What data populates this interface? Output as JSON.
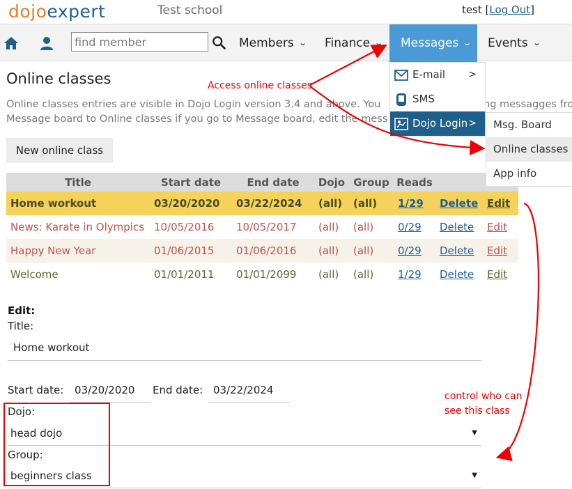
{
  "header": {
    "logo_part1": "dojo",
    "logo_part2": "expert",
    "school": "Test school",
    "user": "test",
    "logout": "Log Out"
  },
  "nav": {
    "search_placeholder": "find member",
    "members": "Members",
    "finance": "Finance",
    "messages": "Messages",
    "events": "Events"
  },
  "messages_menu": {
    "items": [
      {
        "label": "E-mail",
        "icon": "envelope-icon"
      },
      {
        "label": "SMS",
        "icon": "phone-icon"
      },
      {
        "label": "Dojo Login",
        "icon": "login-icon"
      }
    ],
    "submenu": [
      "Msg. Board",
      "Online classes",
      "App info"
    ]
  },
  "page": {
    "title": "Online classes",
    "desc_line1": "Online classes entries are visible in Dojo Login version 3.4 and above. You",
    "desc_line1_tail": "ng messagges fro",
    "desc_line2": "Message board to Online classes if you go to Message board, edit the mess",
    "new_button": "New online class"
  },
  "table": {
    "headers": [
      "Title",
      "Start date",
      "End date",
      "Dojo",
      "Group",
      "Reads",
      "",
      ""
    ],
    "rows": [
      {
        "title": "Home workout",
        "start": "03/20/2020",
        "end": "03/22/2024",
        "dojo": "(all)",
        "group": "(all)",
        "reads": "1/29",
        "delete": "Delete",
        "edit": "Edit"
      },
      {
        "title": "News: Karate in Olympics",
        "start": "10/05/2016",
        "end": "10/05/2017",
        "dojo": "(all)",
        "group": "(all)",
        "reads": "0/29",
        "delete": "Delete",
        "edit": "Edit"
      },
      {
        "title": "Happy New Year",
        "start": "01/06/2015",
        "end": "01/06/2016",
        "dojo": "(all)",
        "group": "(all)",
        "reads": "0/29",
        "delete": "Delete",
        "edit": "Edit"
      },
      {
        "title": "Welcome",
        "start": "01/01/2011",
        "end": "01/01/2099",
        "dojo": "(all)",
        "group": "(all)",
        "reads": "1/29",
        "delete": "Delete",
        "edit": "Edit"
      }
    ]
  },
  "edit": {
    "heading": "Edit:",
    "title_label": "Title:",
    "title_value": "Home workout",
    "start_label": "Start date:",
    "start_value": "03/20/2020",
    "end_label": "End date:",
    "end_value": "03/22/2024",
    "dojo_label": "Dojo:",
    "dojo_value": "head dojo",
    "group_label": "Group:",
    "group_value": "beginners class"
  },
  "annotations": {
    "note1": "Access online classes",
    "note2_line1": "control who can",
    "note2_line2": "see this class",
    "color": "#e00000"
  },
  "colors": {
    "accent": "#4a9ad8",
    "active_menu": "#1f5f8b",
    "highlight_row": "#f5d35a"
  }
}
